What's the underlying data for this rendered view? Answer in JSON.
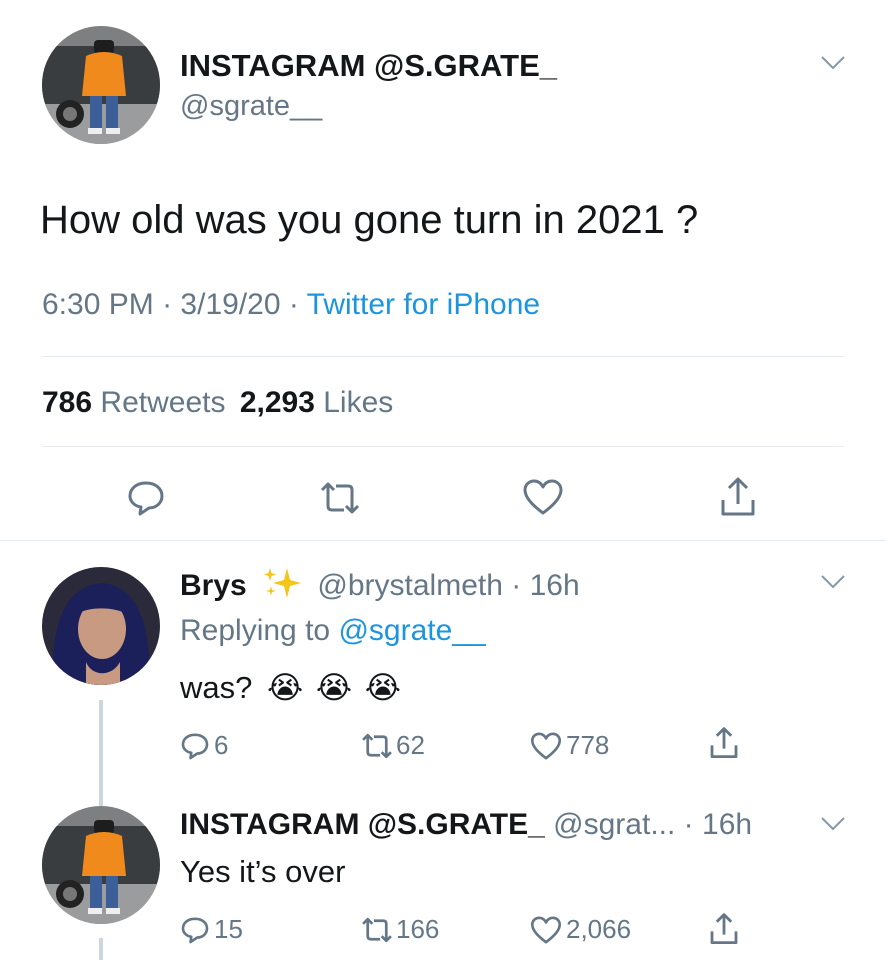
{
  "main_tweet": {
    "display_name": "INSTAGRAM @S.GRATE_",
    "handle": "@sgrate__",
    "text": "How old was you gone turn in 2021 ?",
    "time": "6:30 PM",
    "date": "3/19/20",
    "source": "Twitter for iPhone",
    "sep": "·",
    "retweet_count": "786",
    "retweet_label": "Retweets",
    "like_count": "2,293",
    "like_label": "Likes"
  },
  "reply1": {
    "display_name": "Brys",
    "handle": "@brystalmeth",
    "sep": "·",
    "time": "16h",
    "replying_prefix": "Replying to",
    "replying_handle": "@sgrate__",
    "text": "was?",
    "emoji": [
      "😭",
      "😭",
      "😭"
    ],
    "reply_count": "6",
    "retweet_count": "62",
    "like_count": "778"
  },
  "reply2": {
    "display_name": "INSTAGRAM @S.GRATE_",
    "handle": "@sgrat...",
    "sep": "·",
    "time": "16h",
    "text": "Yes it’s over",
    "reply_count": "15",
    "retweet_count": "166",
    "like_count": "2,066"
  },
  "icons": {
    "reply": "reply-icon",
    "retweet": "retweet-icon",
    "like": "heart-icon",
    "share": "share-icon",
    "caret": "chevron-down-icon",
    "sparkle": "sparkles-icon"
  },
  "colors": {
    "text": "#14171a",
    "secondary": "#657786",
    "link": "#1b95e0",
    "divider": "#e6ecf0",
    "sparkle": "#f5c518"
  }
}
